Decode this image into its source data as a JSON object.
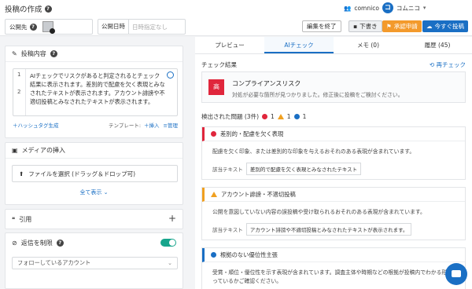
{
  "header": {
    "title": "投稿の作成",
    "account_name": "comnico",
    "account_badge": "コ",
    "account_short": "コムニコ",
    "publish_to_label": "公開先",
    "publish_date_label": "公開日時",
    "publish_date_placeholder": "日時指定なし",
    "btn_end_edit": "編集を終了",
    "btn_draft": "下書き",
    "btn_approve": "承認申請",
    "btn_post_now": "今すぐ投稿"
  },
  "left": {
    "content_title": "投稿内容",
    "line_numbers": [
      "1",
      "2"
    ],
    "editor_text": "AIチェックでリスクがあると判定されるとチェック結果に表示されます。差別的で配慮を欠く表現とみなされたテキストが表示されます。アカウント誹謗や不適切投稿とみなされたテキストが表示されます。",
    "hashtag_link": "＋ハッシュタグ生成",
    "template_label": "テンプレート:",
    "insert_link": "＋挿入",
    "manage_link": "≡管理",
    "media_title": "メディアの挿入",
    "upload_label": "ファイルを選択 (ドラッグ＆ドロップ可)",
    "show_all": "全て表示",
    "quote_title": "引用",
    "reply_title": "返信を制限",
    "reply_select": "フォローしているアカウント"
  },
  "right": {
    "tabs": [
      "プレビュー",
      "AIチェック",
      "メモ (0)",
      "履歴 (45)"
    ],
    "check_title": "チェック結果",
    "recheck": "再チェック",
    "risk_badge": "高",
    "risk_title": "コンプライアンスリスク",
    "risk_desc": "対処が必要な箇所が見つかりました。修正後に投稿をご検討ください。",
    "issues_header": "検出された問題 (3件)",
    "count_red": "1",
    "count_orange": "1",
    "count_blue": "1",
    "issues": [
      {
        "title": "差別的・配慮を欠く表現",
        "desc": "配慮を欠く印象、または差別的な印象を与えるおそれのある表現が含まれています。",
        "ex_label": "該当テキスト",
        "ex_value": "差別的で配慮を欠く表現とみなされたテキスト"
      },
      {
        "title": "アカウント誹謗・不適切投稿",
        "desc": "公開を意図していない内容の誤投稿や受け取られるおそれのある表現が含まれています。",
        "ex_label": "該当テキスト",
        "ex_value": "アカウント誹謗や不適切投稿とみなされたテキストが表示されます。"
      },
      {
        "title": "根拠のない優位性主張",
        "desc": "受賞・順位・優位性を示す表現が含まれています。調査主体や時期などの根拠が投稿内でわかる形になっているかご確認ください。"
      }
    ]
  }
}
